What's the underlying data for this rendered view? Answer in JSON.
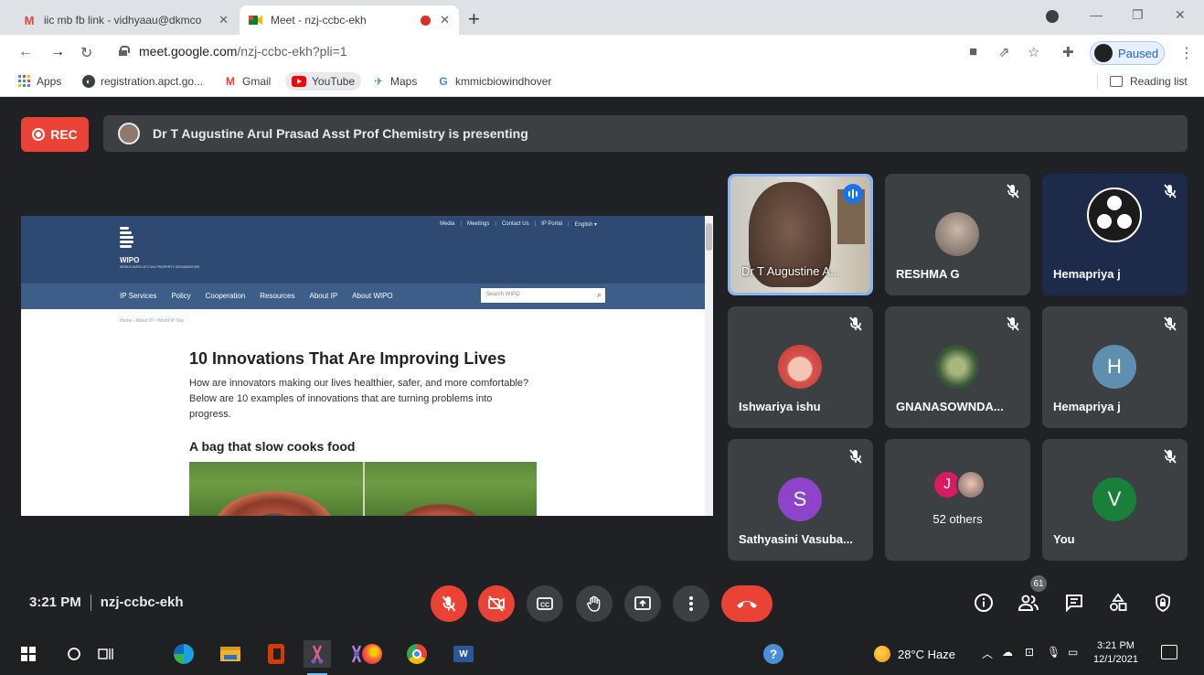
{
  "browser": {
    "tabs": [
      {
        "title": "iic mb fb link - vidhyaau@dkmco",
        "favicon": "gmail-icon",
        "close": "✕"
      },
      {
        "title": "Meet - nzj-ccbc-ekh",
        "favicon": "meet-icon",
        "close": "✕"
      }
    ],
    "new_tab": "+",
    "url_host": "meet.google.com",
    "url_path": "/nzj-ccbc-ekh?pli=1",
    "profile_status": "Paused",
    "bookmarks": [
      {
        "label": "Apps",
        "icon": "apps-grid-icon"
      },
      {
        "label": "registration.apct.go...",
        "icon": "globe-icon"
      },
      {
        "label": "Gmail",
        "icon": "gmail-icon"
      },
      {
        "label": "YouTube",
        "icon": "youtube-icon"
      },
      {
        "label": "Maps",
        "icon": "maps-icon"
      },
      {
        "label": "kmmicbiowindhover",
        "icon": "google-icon"
      }
    ],
    "reading_list": "Reading list"
  },
  "meet": {
    "rec_label": "REC",
    "presenting_text": "Dr T Augustine Arul Prasad Asst Prof Chemistry is presenting",
    "meeting_time": "3:21 PM",
    "meeting_code": "nzj-ccbc-ekh",
    "participant_count": "61",
    "tiles": [
      {
        "name": "Dr T Augustine A...",
        "type": "video",
        "speaking": true
      },
      {
        "name": "RESHMA G",
        "type": "photo",
        "muted": true
      },
      {
        "name": "Hemapriya j",
        "type": "logo",
        "muted": true
      },
      {
        "name": "Ishwariya ishu",
        "type": "photo",
        "muted": true
      },
      {
        "name": "GNANASOWNDA...",
        "type": "photo",
        "muted": true
      },
      {
        "name": "Hemapriya j",
        "type": "initial",
        "initial": "H",
        "color": "#5f8fb0",
        "muted": true
      },
      {
        "name": "Sathyasini Vasuba...",
        "type": "initial",
        "initial": "S",
        "color": "#8e44c9",
        "muted": true
      },
      {
        "name": "52 others",
        "type": "group",
        "initial": "J",
        "color": "#d81b60"
      },
      {
        "name": "You",
        "type": "initial",
        "initial": "V",
        "color": "#188038",
        "muted": true
      }
    ]
  },
  "shared_page": {
    "top_links": [
      "Media",
      "Meetings",
      "Contact Us",
      "IP Portal",
      "English ▾"
    ],
    "logo_name": "WIPO",
    "logo_sub": "WORLD INTELLECTUAL PROPERTY ORGANIZATION",
    "nav": [
      "IP Services",
      "Policy",
      "Cooperation",
      "Resources",
      "About IP",
      "About WIPO"
    ],
    "search_placeholder": "Search WIPO",
    "breadcrumb": "Home › About IP › World IP Day",
    "heading": "10 Innovations That Are Improving Lives",
    "intro": "How are innovators making our lives healthier, safer, and more comfortable? Below are 10 examples of innovations that are turning problems into progress.",
    "subheading": "A bag that slow cooks food"
  },
  "taskbar": {
    "weather": "28°C  Haze",
    "time": "3:21 PM",
    "date": "12/1/2021"
  }
}
